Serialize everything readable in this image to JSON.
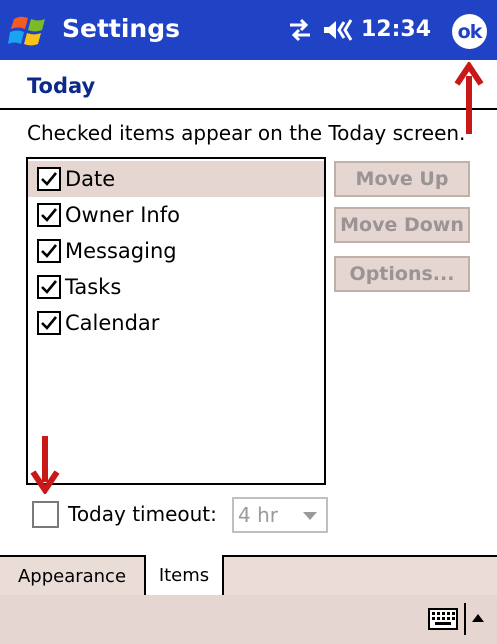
{
  "titlebar": {
    "app_title": "Settings",
    "clock": "12:34",
    "ok_label": "ok",
    "background_color": "#1f43c4",
    "icons": [
      "windows-start-icon",
      "connectivity-icon",
      "volume-icon"
    ]
  },
  "page": {
    "heading": "Today",
    "heading_color": "#0c2a8a",
    "instructions": "Checked items appear on the Today screen."
  },
  "items": [
    {
      "label": "Date",
      "checked": true,
      "selected": true
    },
    {
      "label": "Owner Info",
      "checked": true,
      "selected": false
    },
    {
      "label": "Messaging",
      "checked": true,
      "selected": false
    },
    {
      "label": "Tasks",
      "checked": true,
      "selected": false
    },
    {
      "label": "Calendar",
      "checked": true,
      "selected": false
    }
  ],
  "buttons": {
    "move_up": "Move Up",
    "move_down": "Move Down",
    "options": "Options..."
  },
  "timeout": {
    "label": "Today timeout:",
    "checked": false,
    "value": "4 hr"
  },
  "tabs": [
    {
      "label": "Appearance",
      "active": false
    },
    {
      "label": "Items",
      "active": true
    }
  ],
  "menubar": {
    "icons": [
      "keyboard-icon",
      "sip-arrow-icon"
    ]
  },
  "annotations": {
    "arrow_color": "#c81818"
  }
}
